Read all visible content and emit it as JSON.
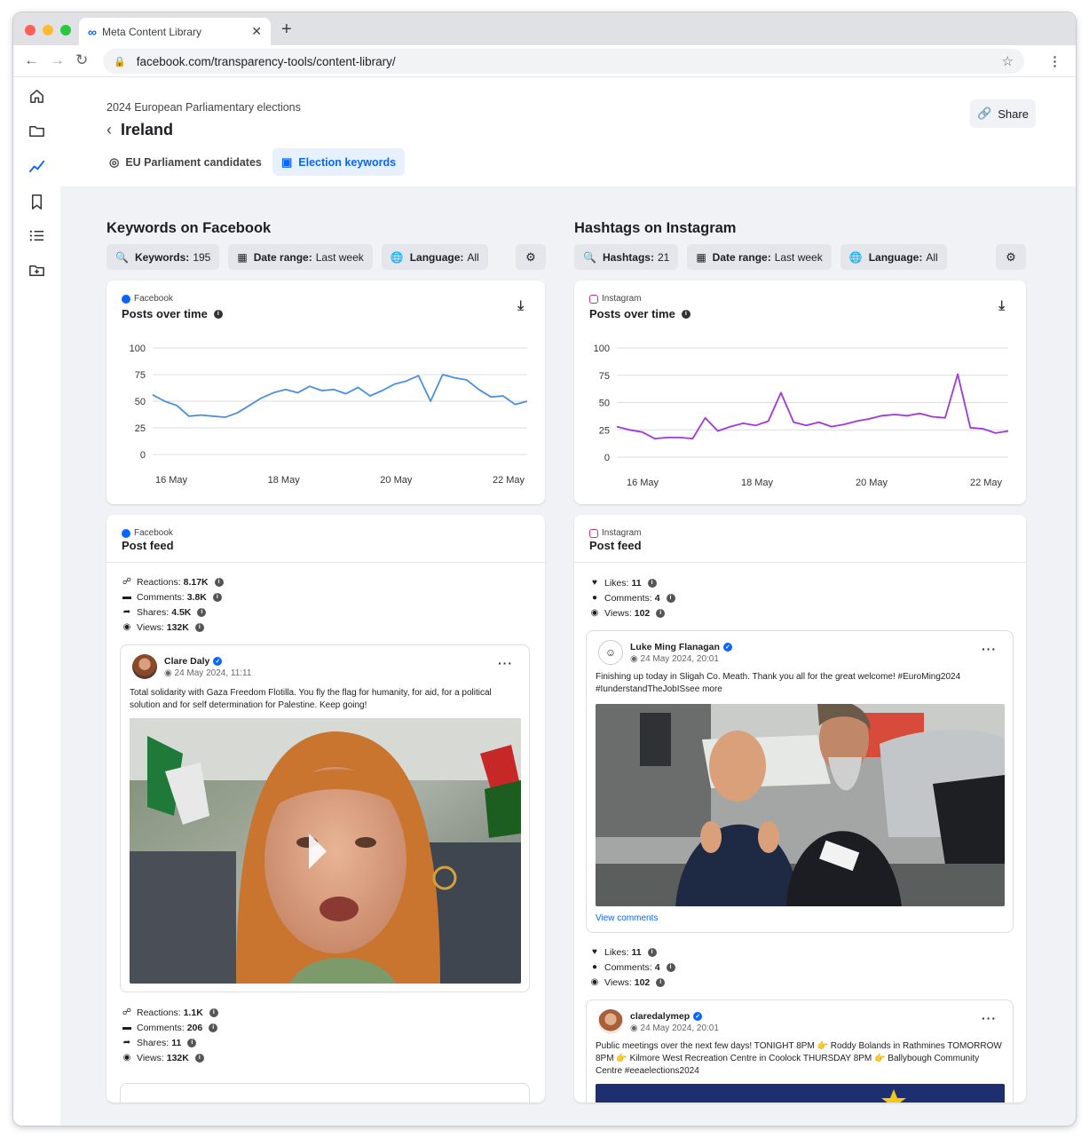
{
  "browser": {
    "tab_title": "Meta Content Library",
    "url": "facebook.com/transparency-tools/content-library/"
  },
  "header": {
    "subtitle": "2024 European Parliamentary elections",
    "title": "Ireland",
    "share_label": "Share",
    "tabs": [
      {
        "label": "EU Parliament candidates",
        "active": false
      },
      {
        "label": "Election keywords",
        "active": true
      }
    ]
  },
  "facebook": {
    "section_title": "Keywords on Facebook",
    "filters": {
      "keywords_label": "Keywords:",
      "keywords_value": "195",
      "date_label": "Date range:",
      "date_value": "Last week",
      "language_label": "Language:",
      "language_value": "All"
    },
    "chart_card": {
      "source": "Facebook",
      "title": "Posts over time"
    },
    "feed_card": {
      "source": "Facebook",
      "title": "Post feed"
    },
    "stats_top": {
      "reactions_label": "Reactions:",
      "reactions": "8.17K",
      "comments_label": "Comments:",
      "comments": "3.8K",
      "shares_label": "Shares:",
      "shares": "4.5K",
      "views_label": "Views:",
      "views": "132K"
    },
    "post": {
      "author": "Clare Daly",
      "date": "24 May 2024, 11:11",
      "text": "Total solidarity with Gaza Freedom Flotilla. You fly the flag for humanity, for aid, for a political solution and for self determination for Palestine. Keep going!"
    },
    "stats_bottom": {
      "reactions_label": "Reactions:",
      "reactions": "1.1K",
      "comments_label": "Comments:",
      "comments": "206",
      "shares_label": "Shares:",
      "shares": "11",
      "views_label": "Views:",
      "views": "132K"
    }
  },
  "instagram": {
    "section_title": "Hashtags on Instagram",
    "filters": {
      "hashtags_label": "Hashtags:",
      "hashtags_value": "21",
      "date_label": "Date range:",
      "date_value": "Last week",
      "language_label": "Language:",
      "language_value": "All"
    },
    "chart_card": {
      "source": "Instagram",
      "title": "Posts over time"
    },
    "feed_card": {
      "source": "Instagram",
      "title": "Post feed"
    },
    "stats_top": {
      "likes_label": "Likes:",
      "likes": "11",
      "comments_label": "Comments:",
      "comments": "4",
      "views_label": "Views:",
      "views": "102"
    },
    "post": {
      "author": "Luke Ming Flanagan",
      "date": "24 May 2024, 20:01",
      "text_line1": "Finishing up today in Sligah Co. Meath. Thank you all for the great welcome! #EuroMing2024",
      "text_line2": "#IunderstandTheJobISsee more",
      "view_comments": "View comments"
    },
    "stats_bottom": {
      "likes_label": "Likes:",
      "likes": "11",
      "comments_label": "Comments:",
      "comments": "4",
      "views_label": "Views:",
      "views": "102"
    },
    "post2": {
      "author": "claredalymep",
      "date": "24 May 2024, 20:01",
      "text": "Public meetings over the next few days! TONIGHT 8PM 👉 Roddy Bolands in Rathmines TOMORROW 8PM 👉 Kilmore West Recreation Centre in Coolock THURSDAY 8PM 👉 Ballybough Community Centre #eeaelections2024"
    }
  },
  "chart_data": [
    {
      "type": "line",
      "title": "Posts over time",
      "x_tick_labels": [
        "16 May",
        "18 May",
        "20 May",
        "22 May"
      ],
      "ylim": [
        0,
        100
      ],
      "y_ticks": [
        0,
        25,
        50,
        75,
        100
      ],
      "grid": true,
      "series": [
        {
          "name": "Facebook",
          "color": "#4a90e2",
          "values": [
            56,
            50,
            46,
            36,
            37,
            36,
            35,
            39,
            46,
            53,
            58,
            61,
            58,
            64,
            60,
            61,
            57,
            63,
            55,
            60,
            66,
            69,
            74,
            50,
            75,
            72,
            70,
            61,
            54,
            55,
            47,
            50
          ]
        }
      ]
    },
    {
      "type": "line",
      "title": "Posts over time",
      "x_tick_labels": [
        "16 May",
        "18 May",
        "20 May",
        "22 May"
      ],
      "ylim": [
        0,
        100
      ],
      "y_ticks": [
        0,
        25,
        50,
        75,
        100
      ],
      "grid": true,
      "series": [
        {
          "name": "Instagram",
          "color": "#a335e0",
          "values": [
            28,
            25,
            23,
            17,
            18,
            18,
            17,
            36,
            24,
            28,
            31,
            29,
            33,
            59,
            32,
            29,
            32,
            28,
            30,
            33,
            35,
            38,
            39,
            38,
            40,
            37,
            36,
            76,
            27,
            26,
            22,
            24
          ]
        }
      ]
    }
  ]
}
